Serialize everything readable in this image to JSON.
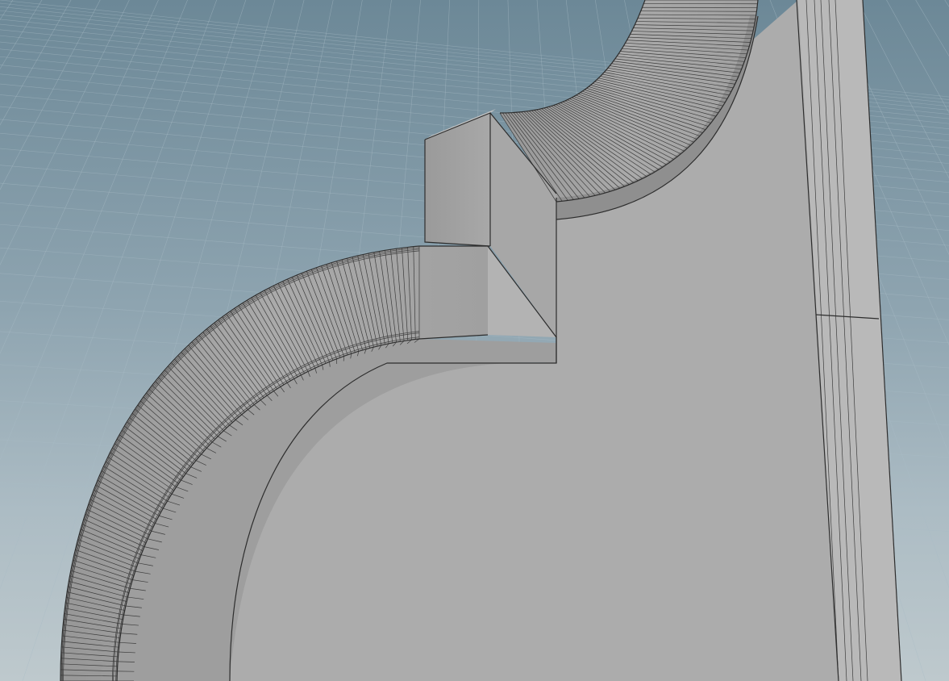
{
  "viewport": {
    "mode": "wireframe-on-shaded",
    "shading": "smooth",
    "show_grid": true,
    "colors": {
      "background_top": "#6f8b99",
      "background_mid": "#98acb6",
      "background_bottom": "#bfc8cc",
      "grid_line": "#a9bcc6",
      "model_face": "#a9a9a9",
      "model_face_light": "#b4b4b4",
      "model_face_dark": "#8e8e8e",
      "wire_edge": "#3a3a3a"
    }
  },
  "scene": {
    "object_type": "curved-molding-bracket",
    "icons": [
      "perspective-grid",
      "polygon-mesh"
    ]
  }
}
